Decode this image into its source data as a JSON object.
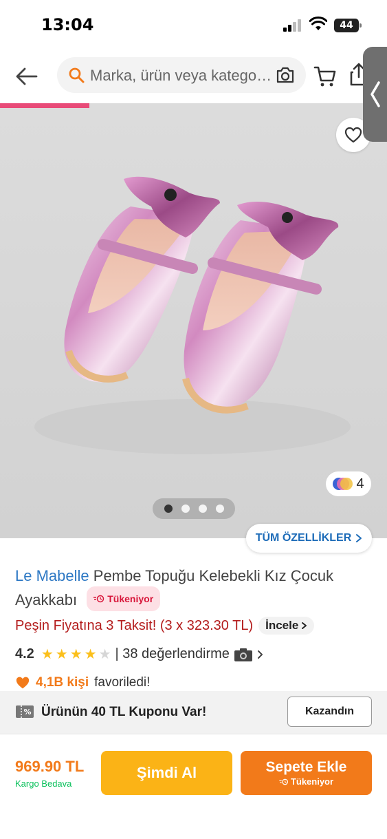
{
  "status_bar": {
    "time": "13:04",
    "battery": "44"
  },
  "header": {
    "search_placeholder": "Marka, ürün veya katego…",
    "icons": [
      "back-arrow-icon",
      "search-icon",
      "camera-icon",
      "cart-icon",
      "share-icon",
      "chevron-left-icon"
    ]
  },
  "gallery": {
    "image_count": 4,
    "active_index": 0,
    "variant_count": "4",
    "all_features_label": "TÜM ÖZELLİKLER"
  },
  "product": {
    "brand": "Le Mabelle",
    "name": "Pembe Topuğu Kelebekli Kız Çocuk Ayakkabı",
    "stock_badge": "Tükeniyor",
    "installment_text": "Peşin Fiyatına 3 Taksit! (3 x 323.30 TL)",
    "installment_link": "İncele",
    "rating": "4.2",
    "rating_stars": 4.2,
    "reviews_text": "| 38 değerlendirme",
    "favorites_count": "4,1B kişi",
    "favorites_label": "favoriledi!"
  },
  "coupon": {
    "text": "Ürünün 40 TL Kuponu Var!",
    "button": "Kazandın"
  },
  "bottom": {
    "price": "969.90 TL",
    "shipping": "Kargo Bedava",
    "buy_now": "Şimdi Al",
    "add_to_cart": "Sepete Ekle",
    "add_to_cart_sub": "Tükeniyor"
  },
  "colors": {
    "accent_orange": "#f27a1a",
    "buy_yellow": "#fbb316",
    "brand_blue": "#2d78c4",
    "alert_red": "#b41d1d",
    "progress_pink": "#e84b78",
    "free_shipping_green": "#0bc15c"
  }
}
